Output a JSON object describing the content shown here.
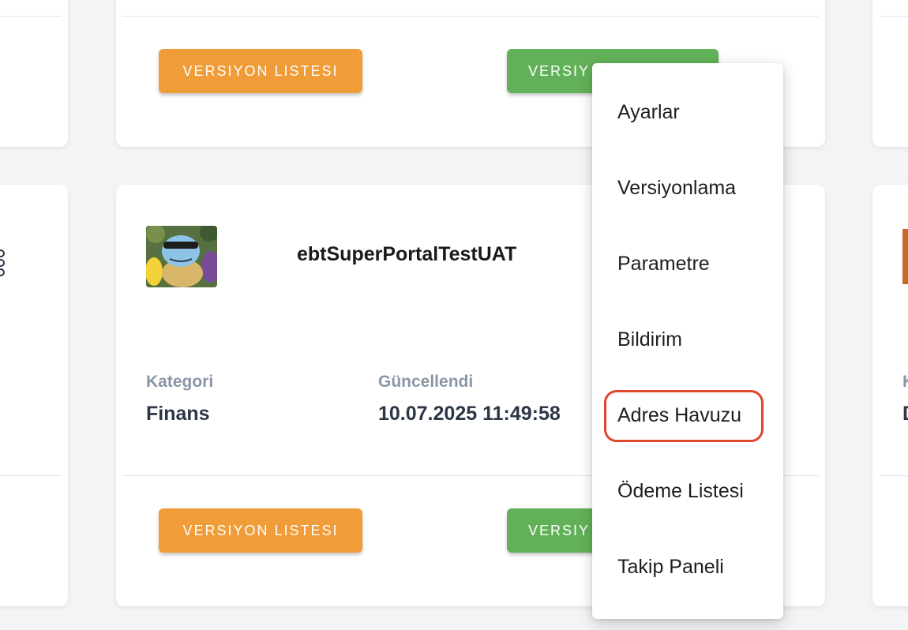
{
  "top_card": {
    "versions_button": "VERSIYON LISTESI",
    "green_button": "VERSIY"
  },
  "middle_card": {
    "app_name": "ebtSuperPortalTestUAT",
    "category_label": "Kategori",
    "category_value": "Finans",
    "updated_label": "Güncellendi",
    "updated_value": "10.07.2025 11:49:58",
    "versions_button": "VERSIYON LISTESI",
    "green_button": "VERSIY"
  },
  "right_card": {
    "label_fragment": "K",
    "value_fragment": "D"
  },
  "context_menu": {
    "items": [
      {
        "label": "Ayarlar"
      },
      {
        "label": "Versiyonlama"
      },
      {
        "label": "Parametre"
      },
      {
        "label": "Bildirim"
      },
      {
        "label": "Adres Havuzu"
      },
      {
        "label": "Ödeme Listesi"
      },
      {
        "label": "Takip Paneli"
      }
    ],
    "highlighted_item": "Adres Havuzu"
  },
  "colors": {
    "orange_button": "#f09c38",
    "green_button": "#62b158",
    "highlight_border": "#e1452d",
    "label_gray": "#8a96a6"
  }
}
